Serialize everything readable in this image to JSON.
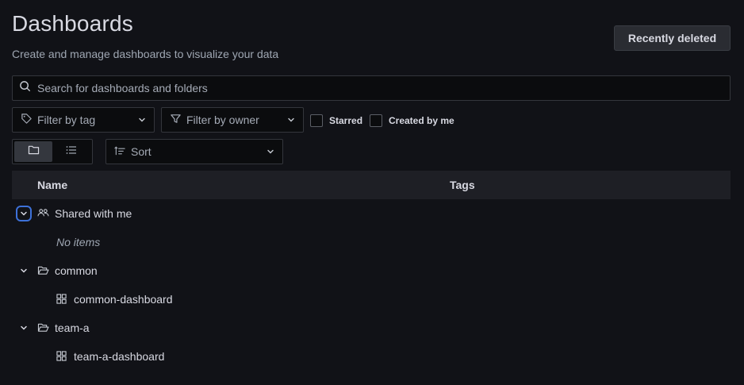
{
  "page": {
    "title": "Dashboards",
    "subtitle": "Create and manage dashboards to visualize your data",
    "recently_deleted_label": "Recently deleted"
  },
  "search": {
    "placeholder": "Search for dashboards and folders",
    "icon": "search-icon"
  },
  "filters": {
    "tag": {
      "label": "Filter by tag",
      "icon": "tag-icon"
    },
    "owner": {
      "label": "Filter by owner",
      "icon": "filter-icon"
    },
    "starred": {
      "label": "Starred",
      "checked": false
    },
    "created_by_me": {
      "label": "Created by me",
      "checked": false
    }
  },
  "view": {
    "active": "folder",
    "options": [
      "folder-view-icon",
      "list-view-icon"
    ]
  },
  "sort": {
    "label": "Sort",
    "icon": "sort-icon"
  },
  "table": {
    "headers": {
      "name": "Name",
      "tags": "Tags"
    },
    "rows": [
      {
        "type": "folder",
        "label": "Shared with me",
        "icon": "users-icon",
        "expanded": true
      },
      {
        "type": "empty",
        "label": "No items"
      },
      {
        "type": "folder",
        "label": "common",
        "icon": "folder-open-icon",
        "expanded": true
      },
      {
        "type": "dashboard",
        "label": "common-dashboard",
        "icon": "apps-icon"
      },
      {
        "type": "folder",
        "label": "team-a",
        "icon": "folder-open-icon",
        "expanded": true
      },
      {
        "type": "dashboard",
        "label": "team-a-dashboard",
        "icon": "apps-icon"
      }
    ]
  },
  "colors": {
    "background": "#111217",
    "focus_ring": "#3d71d9",
    "header_bg": "#1e1f25",
    "input_bg": "#0b0c0e"
  }
}
